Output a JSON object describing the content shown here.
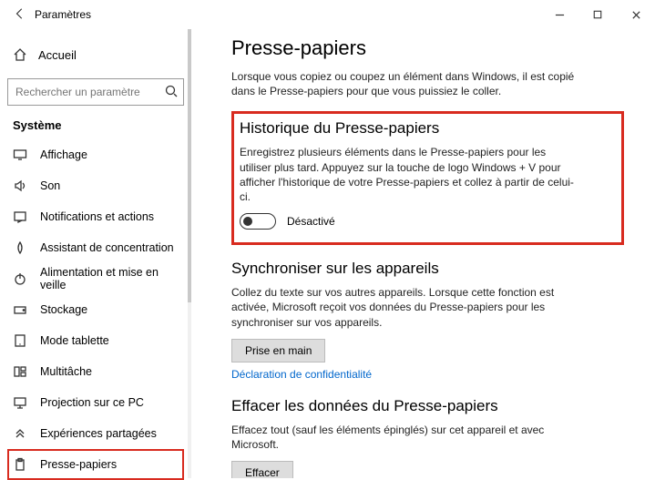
{
  "window": {
    "title": "Paramètres"
  },
  "sidebar": {
    "home": "Accueil",
    "search_placeholder": "Rechercher un paramètre",
    "category": "Système",
    "items": [
      {
        "label": "Affichage"
      },
      {
        "label": "Son"
      },
      {
        "label": "Notifications et actions"
      },
      {
        "label": "Assistant de concentration"
      },
      {
        "label": "Alimentation et mise en veille"
      },
      {
        "label": "Stockage"
      },
      {
        "label": "Mode tablette"
      },
      {
        "label": "Multitâche"
      },
      {
        "label": "Projection sur ce PC"
      },
      {
        "label": "Expériences partagées"
      },
      {
        "label": "Presse-papiers"
      }
    ]
  },
  "page": {
    "title": "Presse-papiers",
    "intro": "Lorsque vous copiez ou coupez un élément dans Windows, il est copié dans le Presse-papiers pour que vous puissiez le coller.",
    "history": {
      "title": "Historique du Presse-papiers",
      "desc": "Enregistrez plusieurs éléments dans le Presse-papiers pour les utiliser plus tard. Appuyez sur la touche de logo Windows + V pour afficher l'historique de votre Presse-papiers et collez à partir de celui-ci.",
      "toggle_state": "Désactivé"
    },
    "sync": {
      "title": "Synchroniser sur les appareils",
      "desc": "Collez du texte sur vos autres appareils. Lorsque cette fonction est activée, Microsoft reçoit vos données du Presse-papiers pour les synchroniser sur vos appareils.",
      "button": "Prise en main",
      "privacy_link": "Déclaration de confidentialité"
    },
    "clear": {
      "title": "Effacer les données du Presse-papiers",
      "desc": "Effacez tout (sauf les éléments épinglés) sur cet appareil et avec Microsoft.",
      "button": "Effacer"
    }
  }
}
